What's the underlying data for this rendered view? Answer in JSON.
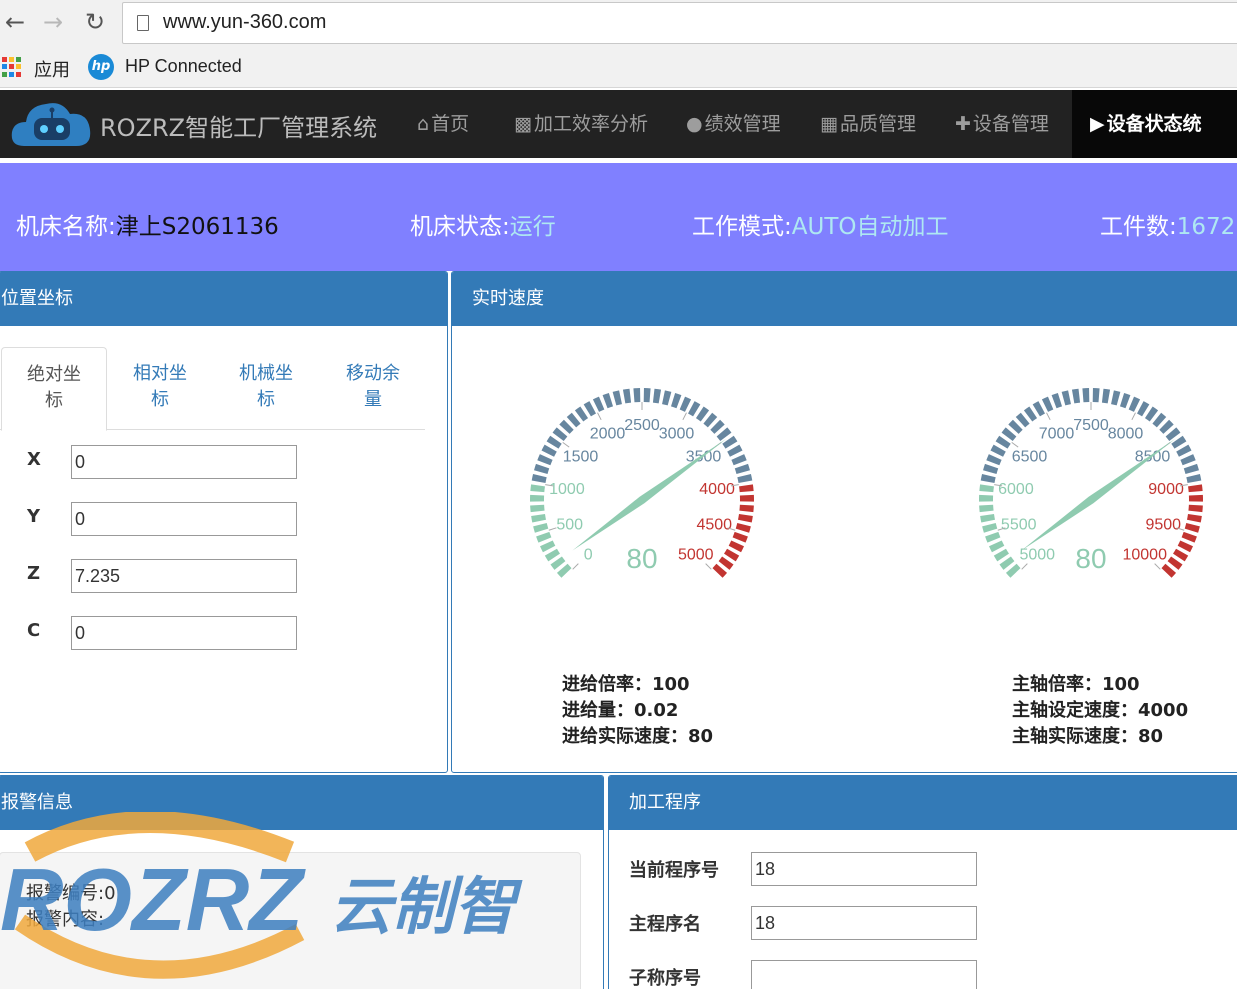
{
  "browser": {
    "url": "www.yun-360.com",
    "bookmarks": [
      {
        "label": "应用",
        "icon": "apps-grid-icon"
      },
      {
        "label": "HP Connected",
        "icon": "hp-logo-icon"
      }
    ]
  },
  "navbar": {
    "title": "ROZRZ智能工厂管理系统",
    "items": [
      {
        "label": "首页",
        "icon": "home-icon"
      },
      {
        "label": "加工效率分析",
        "icon": "bar-chart-icon"
      },
      {
        "label": "绩效管理",
        "icon": "user-icon"
      },
      {
        "label": "品质管理",
        "icon": "grid-icon"
      },
      {
        "label": "设备管理",
        "icon": "plus-icon"
      },
      {
        "label": "设备状态统计",
        "icon": "play-square-icon"
      }
    ]
  },
  "machine": {
    "name_label": "机床名称:",
    "name": "津上S2061136",
    "status_label": "机床状态:",
    "status": "运行",
    "mode_label": "工作模式:",
    "mode": "AUTO自动加工",
    "count_label": "工件数:",
    "count": "1672"
  },
  "position": {
    "title": "位置坐标",
    "tabs": [
      {
        "line1": "绝对坐",
        "line2": "标"
      },
      {
        "line1": "相对坐",
        "line2": "标"
      },
      {
        "line1": "机械坐",
        "line2": "标"
      },
      {
        "line1": "移动余",
        "line2": "量"
      }
    ],
    "axes": [
      {
        "label": "X",
        "value": "0"
      },
      {
        "label": "Y",
        "value": "0"
      },
      {
        "label": "Z",
        "value": "7.235"
      },
      {
        "label": "C",
        "value": "0"
      }
    ]
  },
  "speed": {
    "title": "实时速度",
    "feed_gauge": {
      "value": "80",
      "ticks": [
        "0",
        "500",
        "1000",
        "1500",
        "2000",
        "2500",
        "3000",
        "3500",
        "4000",
        "4500",
        "5000"
      ]
    },
    "spindle_gauge": {
      "value": "80",
      "ticks": [
        "5000",
        "5500",
        "6000",
        "6500",
        "7000",
        "7500",
        "8000",
        "8500",
        "9000",
        "9500",
        "10000"
      ]
    },
    "feed_info": [
      {
        "label": "进给倍率：",
        "value": "100"
      },
      {
        "label": "进给量：",
        "value": "0.02"
      },
      {
        "label": "进给实际速度：",
        "value": "80"
      }
    ],
    "spindle_info": [
      {
        "label": "主轴倍率：",
        "value": "100"
      },
      {
        "label": "主轴设定速度：",
        "value": "4000"
      },
      {
        "label": "主轴实际速度：",
        "value": "80"
      }
    ],
    "colors": {
      "green": "#8fcbb0",
      "blue": "#67869f",
      "red": "#c23531"
    }
  },
  "alarm": {
    "title": "报警信息",
    "number_label": "报警编号:",
    "number": "0",
    "content_label": "报警内容:",
    "content": ""
  },
  "program": {
    "title": "加工程序",
    "rows": [
      {
        "label": "当前程序号",
        "value": "18"
      },
      {
        "label": "主程序名",
        "value": "18"
      },
      {
        "label": "子称序号",
        "value": ""
      }
    ]
  },
  "watermark": {
    "text": "ROZRZ 云制智"
  }
}
